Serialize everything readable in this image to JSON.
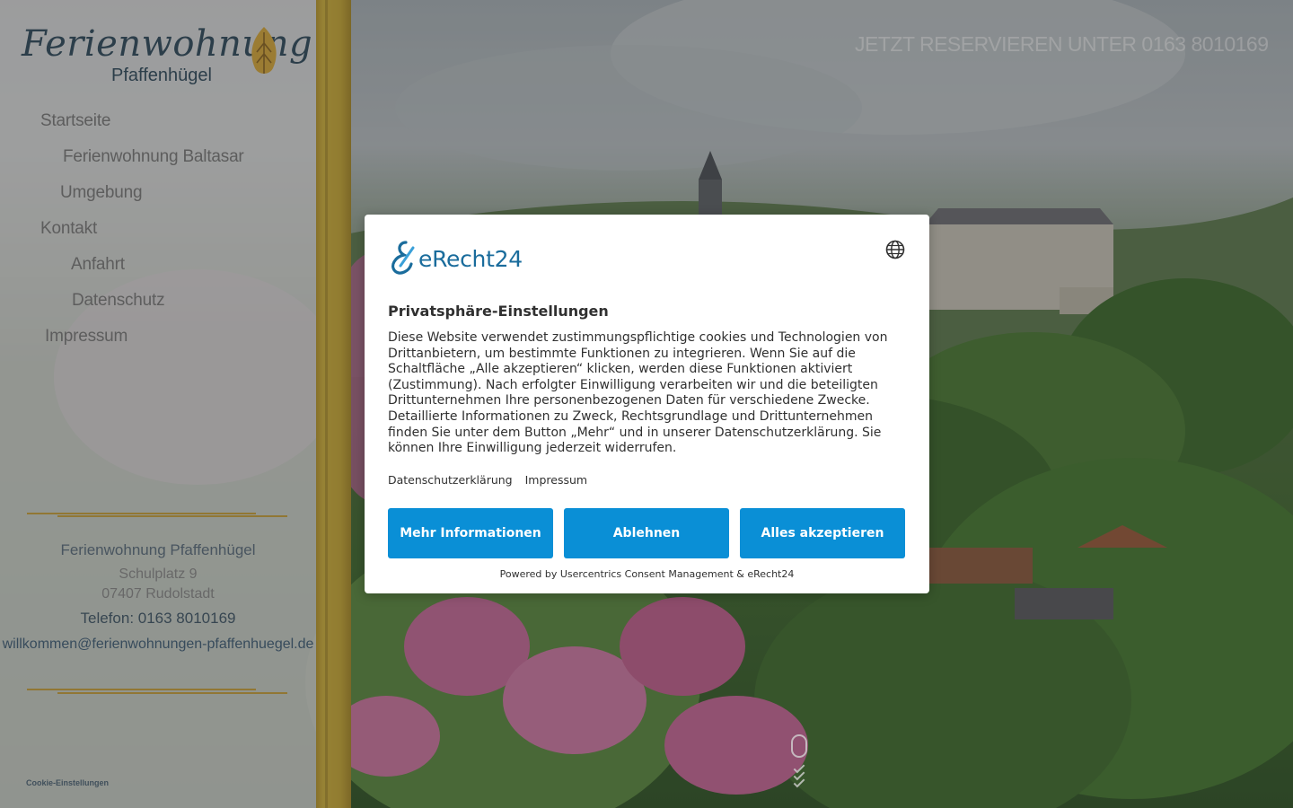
{
  "site": {
    "logo": {
      "script": "Ferienwohnung",
      "sub": "Pfaffenhügel"
    },
    "reserve_text": "JETZT RESERVIEREN UNTER 0163 8010169",
    "nav": [
      {
        "label": "Startseite"
      },
      {
        "label": "Ferienwohnung Baltasar"
      },
      {
        "label": "Umgebung"
      },
      {
        "label": "Kontakt"
      },
      {
        "label": "Anfahrt"
      },
      {
        "label": "Datenschutz"
      },
      {
        "label": "Impressum"
      }
    ],
    "contact": {
      "name": "Ferienwohnung Pfaffenhügel",
      "street": "Schulplatz 9",
      "city": "07407 Rudolstadt",
      "phone": "Telefon: 0163 8010169",
      "email": "willkommen@ferienwohnungen-pfaffenhuegel.de"
    },
    "cookie_settings": "Cookie-Einstellungen",
    "colors": {
      "gold": "#c9a935",
      "navy": "#2e4a5c",
      "button_blue": "#0a8fd6"
    }
  },
  "consent": {
    "brand": "eRecht24",
    "title": "Privatsphäre-Einstellungen",
    "body": "Diese Website verwendet zustimmungspflichtige cookies und Technologien von Drittanbietern, um bestimmte Funktionen zu integrieren. Wenn Sie auf die Schaltfläche „Alle akzeptieren“ klicken, werden diese Funktionen aktiviert (Zustimmung). Nach erfolgter Einwilligung verarbeiten wir und die beteiligten Drittunternehmen Ihre personenbezogenen Daten für verschiedene Zwecke. Detaillierte Informationen zu Zweck, Rechtsgrundlage und Drittunternehmen finden Sie unter dem Button „Mehr“ und in unserer Datenschutzerklärung. Sie können Ihre Einwilligung jederzeit widerrufen.",
    "links": {
      "privacy": "Datenschutzerklärung",
      "imprint": "Impressum"
    },
    "buttons": {
      "more": "Mehr Informationen",
      "deny": "Ablehnen",
      "accept": "Alles akzeptieren"
    },
    "powered_by": "Powered by Usercentrics Consent Management & eRecht24",
    "icons": {
      "language": "globe-icon",
      "brand": "erecht24-logo-icon"
    }
  }
}
